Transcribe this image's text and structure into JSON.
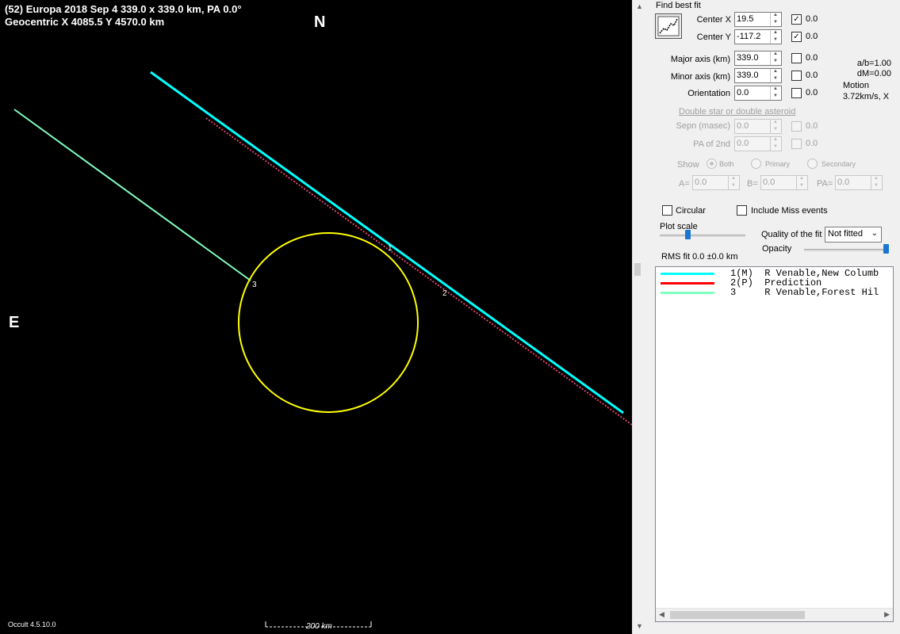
{
  "plot": {
    "header_line1": "(52) Europa  2018 Sep 4  339.0 x 339.0 km, PA 0.0°",
    "header_line2": "Geocentric  X  4085.5  Y 4570.0 km",
    "north": "N",
    "east": "E",
    "version": "Occult 4.5.10.0",
    "scale_label": "200 km",
    "chord_labels": [
      "1",
      "2",
      "3"
    ],
    "colors": {
      "background": "#000000",
      "asteroid": "#ffff00",
      "chord_1": "#00ffff",
      "prediction": "#ff2030",
      "chord_3": "#80ffc0"
    }
  },
  "panel": {
    "find_best_fit": "Find best fit",
    "center_x": {
      "label": "Center X",
      "value": "19.5",
      "checked": true,
      "resid": "0.0"
    },
    "center_y": {
      "label": "Center Y",
      "value": "-117.2",
      "checked": true,
      "resid": "0.0"
    },
    "major_axis": {
      "label": "Major axis (km)",
      "value": "339.0",
      "checked": false,
      "resid": "0.0"
    },
    "minor_axis": {
      "label": "Minor axis (km)",
      "value": "339.0",
      "checked": false,
      "resid": "0.0"
    },
    "orientation": {
      "label": "Orientation",
      "value": "0.0",
      "checked": false,
      "resid": "0.0"
    },
    "ab_ratio": "a/b=1.00",
    "dm": "dM=0.00",
    "motion_label": "Motion",
    "motion_value": "3.72km/s, X",
    "double_star_link": "Double star  or  double asteroid",
    "sepn": {
      "label": "Sepn (masec)",
      "value": "0.0",
      "resid": "0.0"
    },
    "pa2nd": {
      "label": "PA of 2nd",
      "value": "0.0",
      "resid": "0.0"
    },
    "show_label": "Show",
    "show_both": "Both",
    "show_primary": "Primary",
    "show_secondary": "Secondary",
    "a_label": "A=",
    "a_value": "0.0",
    "b_label": "B=",
    "b_value": "0.0",
    "pa_label": "PA=",
    "pa_value": "0.0",
    "circular": "Circular",
    "include_miss": "Include Miss events",
    "plot_scale": "Plot scale",
    "quality_label": "Quality of the fit",
    "quality_value": "Not fitted",
    "opacity": "Opacity",
    "rms_fit": "RMS fit 0.0 ±0.0 km",
    "legend": [
      {
        "text": "1(M)  R Venable,New Columb",
        "color": "#00ffff"
      },
      {
        "text": "2(P)  Prediction",
        "color": "#ff0000"
      },
      {
        "text": "3     R Venable,Forest Hil",
        "color": "#80ffc0"
      }
    ]
  }
}
